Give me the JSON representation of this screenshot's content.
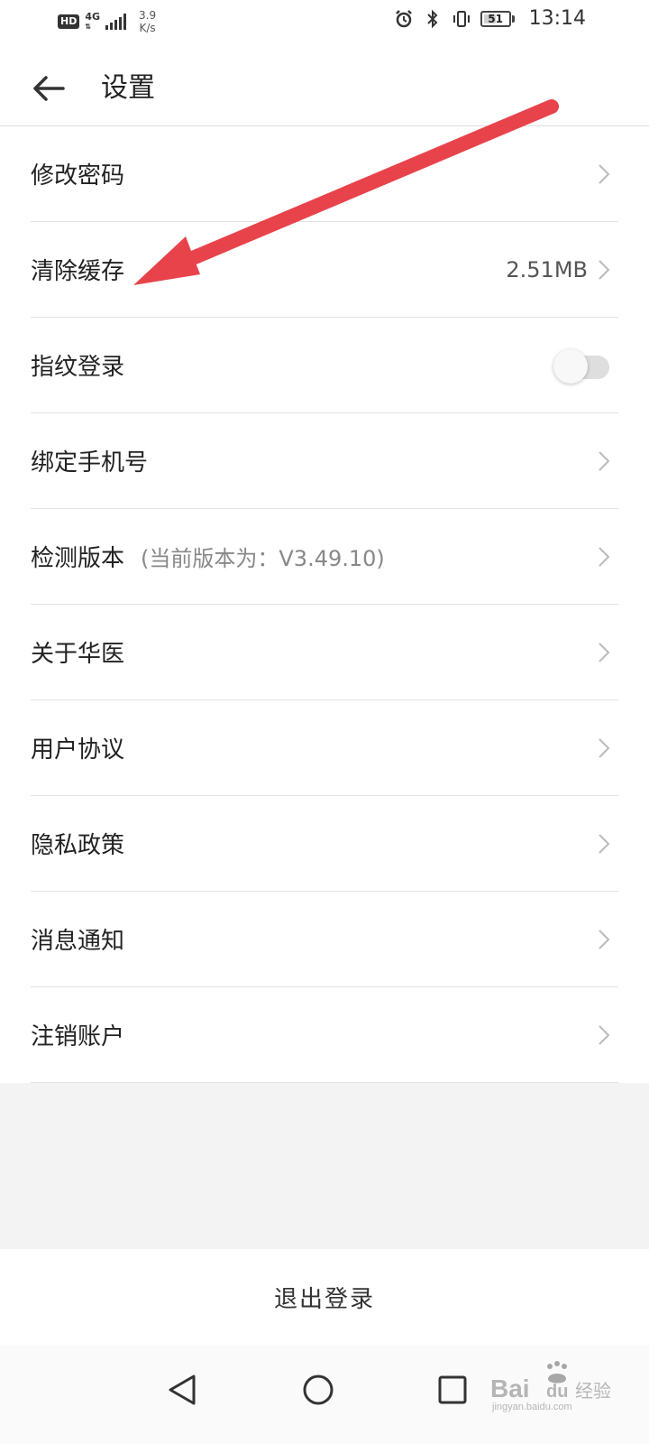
{
  "status_bar": {
    "hd": "HD",
    "network": "4G",
    "speed_value": "3.9",
    "speed_unit": "K/s",
    "battery": "51",
    "battery_level": 0.51,
    "time": "13:14"
  },
  "header": {
    "title": "设置"
  },
  "settings": [
    {
      "label": "修改密码",
      "chevron": true
    },
    {
      "label": "清除缓存",
      "value": "2.51MB",
      "chevron": true
    },
    {
      "label": "指纹登录",
      "toggle": false
    },
    {
      "label": "绑定手机号",
      "chevron": true
    },
    {
      "label": "检测版本",
      "sub": "(当前版本为：V3.49.10)",
      "chevron": true
    },
    {
      "label": "关于华医",
      "chevron": true
    },
    {
      "label": "用户协议",
      "chevron": true
    },
    {
      "label": "隐私政策",
      "chevron": true
    },
    {
      "label": "消息通知",
      "chevron": true
    },
    {
      "label": "注销账户",
      "chevron": true
    }
  ],
  "logout_label": "退出登录",
  "watermark": {
    "brand": "Bai",
    "brand2": "du",
    "cn": "经验",
    "url": "jingyan.baidu.com"
  },
  "colors": {
    "annotation_arrow": "#e8434b",
    "divider": "#e3e3e3"
  }
}
